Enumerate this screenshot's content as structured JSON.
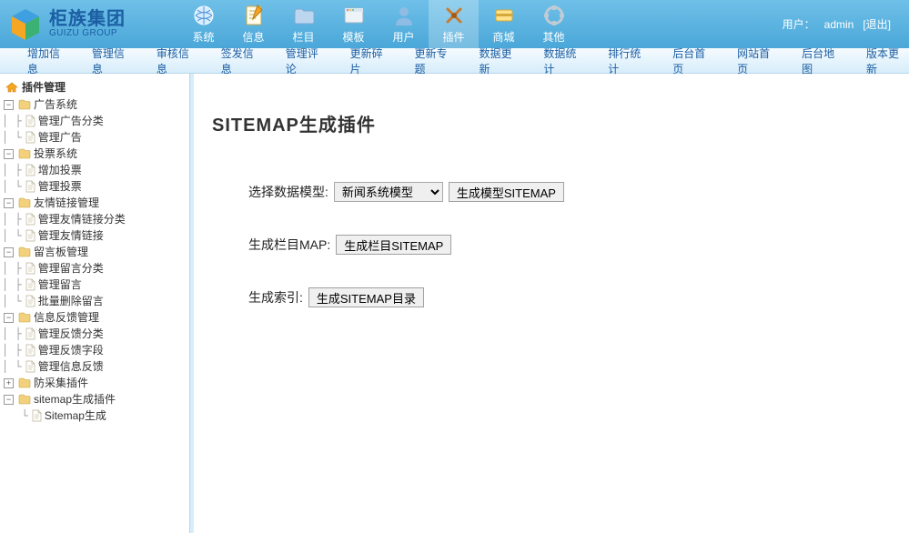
{
  "brand": {
    "cn": "柜族集团",
    "en": "GUIZU GROUP"
  },
  "main_tabs": [
    {
      "key": "system",
      "label": "系统"
    },
    {
      "key": "info",
      "label": "信息"
    },
    {
      "key": "column",
      "label": "栏目"
    },
    {
      "key": "template",
      "label": "模板"
    },
    {
      "key": "user",
      "label": "用户"
    },
    {
      "key": "plugin",
      "label": "插件",
      "active": true
    },
    {
      "key": "mall",
      "label": "商城"
    },
    {
      "key": "other",
      "label": "其他"
    }
  ],
  "user_info": {
    "label": "用户：",
    "name": "admin",
    "logout": "[退出]"
  },
  "subnav": [
    "增加信息",
    "管理信息",
    "审核信息",
    "签发信息",
    "管理评论",
    "更新碎片",
    "更新专题",
    "数据更新",
    "数据统计",
    "排行统计",
    "后台首页",
    "网站首页",
    "后台地图",
    "版本更新"
  ],
  "sidebar": {
    "root": "插件管理",
    "groups": [
      {
        "label": "广告系统",
        "expanded": true,
        "items": [
          "管理广告分类",
          "管理广告"
        ]
      },
      {
        "label": "投票系统",
        "expanded": true,
        "items": [
          "增加投票",
          "管理投票"
        ]
      },
      {
        "label": "友情链接管理",
        "expanded": true,
        "items": [
          "管理友情链接分类",
          "管理友情链接"
        ]
      },
      {
        "label": "留言板管理",
        "expanded": true,
        "items": [
          "管理留言分类",
          "管理留言",
          "批量删除留言"
        ]
      },
      {
        "label": "信息反馈管理",
        "expanded": true,
        "items": [
          "管理反馈分类",
          "管理反馈字段",
          "管理信息反馈"
        ]
      },
      {
        "label": "防采集插件",
        "expanded": false,
        "items": []
      },
      {
        "label": "sitemap生成插件",
        "expanded": true,
        "items": [
          "Sitemap生成"
        ]
      }
    ]
  },
  "content": {
    "title": "SITEMAP生成插件",
    "rows": {
      "model": {
        "label": "选择数据模型:",
        "option": "新闻系统模型",
        "button": "生成模型SITEMAP"
      },
      "column": {
        "label": "生成栏目MAP:",
        "button": "生成栏目SITEMAP"
      },
      "index": {
        "label": "生成索引:",
        "button": "生成SITEMAP目录"
      }
    }
  }
}
